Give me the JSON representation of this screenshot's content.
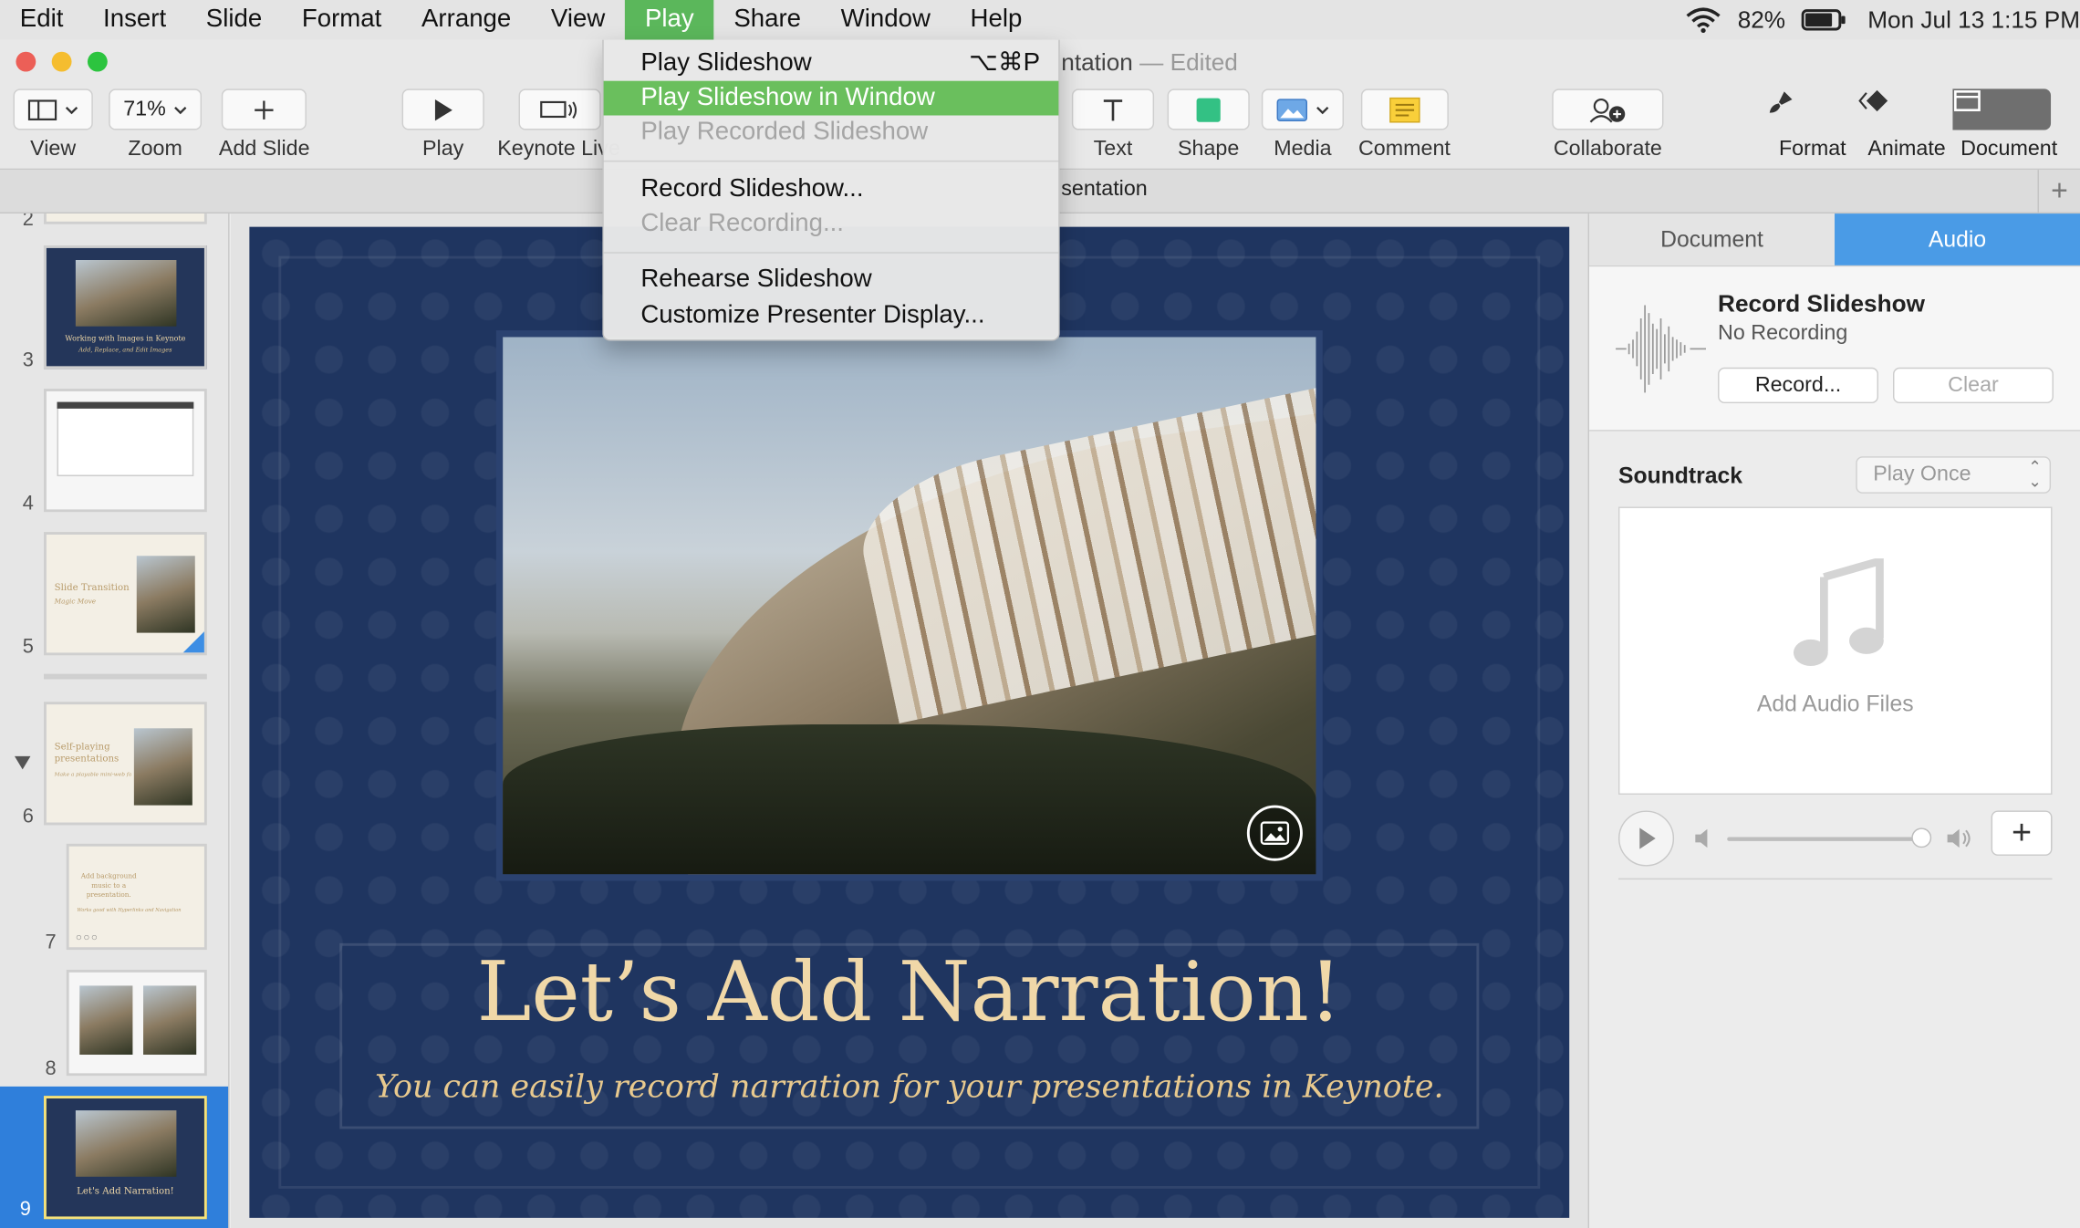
{
  "menubar": {
    "items": [
      "Edit",
      "Insert",
      "Slide",
      "Format",
      "Arrange",
      "View",
      "Play",
      "Share",
      "Window",
      "Help"
    ],
    "active": "Play",
    "battery": "82%",
    "battery_level": 0.82,
    "clock": "Mon Jul 13  1:15 PM"
  },
  "window": {
    "title_partial": "ntation",
    "edited": "— Edited",
    "tab_title": "sentation"
  },
  "toolbar": {
    "view": "View",
    "zoom_value": "71%",
    "zoom": "Zoom",
    "add_slide": "Add Slide",
    "play": "Play",
    "keynote_live": "Keynote Live",
    "text": "Text",
    "shape": "Shape",
    "media": "Media",
    "comment": "Comment",
    "collaborate": "Collaborate",
    "format": "Format",
    "animate": "Animate",
    "document": "Document"
  },
  "play_menu": {
    "items": [
      {
        "label": "Play Slideshow",
        "shortcut": "⌥⌘P",
        "state": "normal"
      },
      {
        "label": "Play Slideshow in Window",
        "shortcut": "",
        "state": "highlighted"
      },
      {
        "label": "Play Recorded Slideshow",
        "shortcut": "",
        "state": "disabled"
      },
      {
        "label": "Record Slideshow...",
        "shortcut": "",
        "state": "normal"
      },
      {
        "label": "Clear Recording...",
        "shortcut": "",
        "state": "disabled"
      },
      {
        "label": "Rehearse Slideshow",
        "shortcut": "",
        "state": "normal"
      },
      {
        "label": "Customize Presenter Display...",
        "shortcut": "",
        "state": "normal"
      }
    ]
  },
  "navigator": {
    "slide_numbers": [
      "2",
      "3",
      "4",
      "5",
      "6",
      "7",
      "8",
      "9"
    ],
    "thumb_texts": {
      "s3_title": "Working with Images in Keynote",
      "s3_sub": "Add, Replace, and Edit Images",
      "s5_title": "Slide Transition",
      "s5_sub": "Magic Move",
      "s6_title": "Self-playing presentations",
      "s6_sub": "Make a playable mini-web format",
      "s7_title": "Add background music to a presentation.",
      "s7_sub": "Works good with Hyperlinks and Navigation",
      "s9_title": "Let's Add Narration!"
    },
    "selected": "9"
  },
  "slide": {
    "title": "Let’s Add Narration!",
    "subtitle": "You can easily record narration for your presentations in Keynote."
  },
  "inspector": {
    "tabs": [
      "Document",
      "Audio"
    ],
    "active_tab": "Audio",
    "record_title": "Record Slideshow",
    "record_status": "No Recording",
    "record_button": "Record...",
    "clear_button": "Clear",
    "soundtrack_label": "Soundtrack",
    "soundtrack_mode": "Play Once",
    "add_audio": "Add Audio Files",
    "volume": 0.98
  },
  "colors": {
    "accent_blue": "#2f7fdb",
    "menu_highlight": "#6abf5d",
    "slide_bg": "#1f3560",
    "title_gold": "#f0d8a8"
  }
}
